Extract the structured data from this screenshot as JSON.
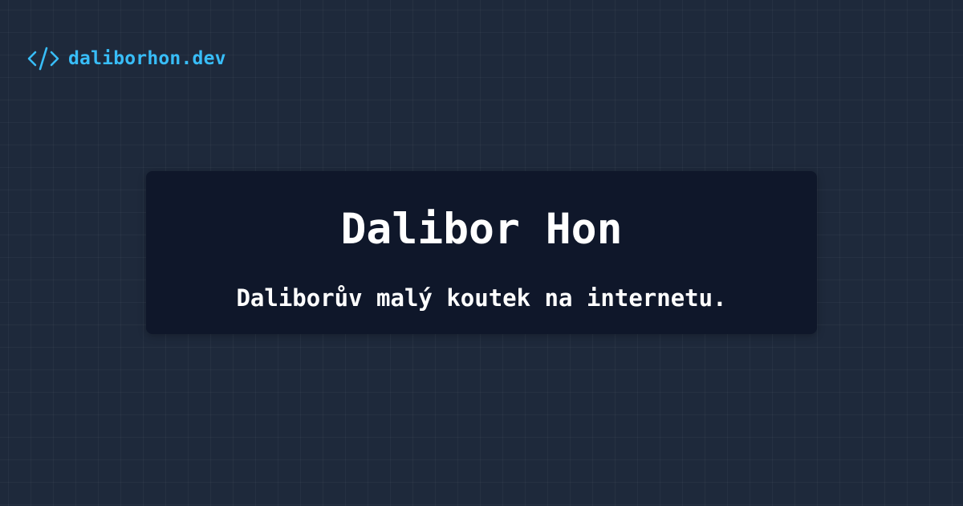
{
  "brand": {
    "icon": "code-icon",
    "name": "daliborhon.dev"
  },
  "hero": {
    "title": "Dalibor Hon",
    "subtitle": "Daliborův malý koutek na internetu."
  },
  "colors": {
    "background": "#1e293b",
    "card": "#0f172a",
    "accent": "#38bdf8",
    "text": "#ffffff"
  }
}
